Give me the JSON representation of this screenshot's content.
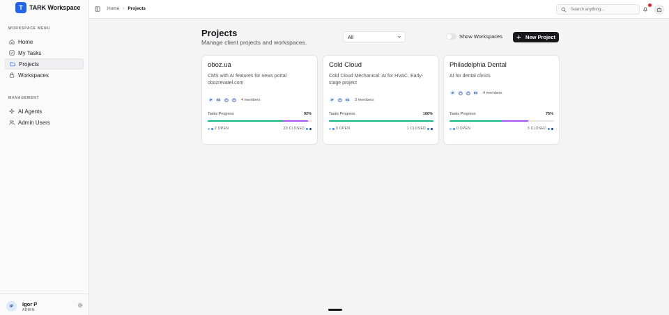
{
  "brand": {
    "logo_letter": "T",
    "name": "TARK Workspace",
    "accent": "#2563eb"
  },
  "sidebar": {
    "workspace_label": "WORKSPACE MENU",
    "workspace_items": [
      {
        "label": "Home",
        "icon": "home-icon"
      },
      {
        "label": "My Tasks",
        "icon": "checkbox-icon"
      },
      {
        "label": "Projects",
        "icon": "folder-icon",
        "active": true
      },
      {
        "label": "Workspaces",
        "icon": "lock-icon"
      }
    ],
    "management_label": "MANAGEMENT",
    "management_items": [
      {
        "label": "AI Agents",
        "icon": "sparkle-icon"
      },
      {
        "label": "Admin Users",
        "icon": "users-icon"
      }
    ],
    "user": {
      "initials": "IP",
      "name": "Igor P",
      "role": "ADMIN"
    }
  },
  "topbar": {
    "breadcrumb": [
      "Home",
      "Projects"
    ],
    "search_placeholder": "Search anything...",
    "notification_color": "#dc2626"
  },
  "page": {
    "title": "Projects",
    "subtitle": "Manage client projects and workspaces.",
    "filter_value": "All",
    "toggle_label": "Show Workspaces",
    "new_button_label": "New Project"
  },
  "projects": [
    {
      "name": "oboz.ua",
      "description": "CMS with AI features for news portal obozrevatel.com",
      "avatars": [
        "IP",
        "ES",
        "",
        ""
      ],
      "members": "4 members",
      "progress_label": "Tasks Progress",
      "progress_pct": "92%",
      "progress_done_fraction": 0.72,
      "progress_review_fraction": 0.24,
      "open": "2 OPEN",
      "closed": "23 CLOSED"
    },
    {
      "name": "Cold Cloud",
      "description": "Cold Cloud Mechanical: AI for HVAC. Early-stage project",
      "avatars": [
        "IP",
        "",
        "ES"
      ],
      "members": "3 members",
      "progress_label": "Tasks Progress",
      "progress_pct": "100%",
      "progress_done_fraction": 1.0,
      "progress_review_fraction": 0.0,
      "open": "0 OPEN",
      "closed": "1 CLOSED"
    },
    {
      "name": "Philadelphia Dental",
      "description": "AI for dental clinics",
      "avatars": [
        "IP",
        "",
        "",
        "ES"
      ],
      "members": "4 members",
      "progress_label": "Tasks Progress",
      "progress_pct": "75%",
      "progress_done_fraction": 0.5,
      "progress_review_fraction": 0.25,
      "open": "0 OPEN",
      "closed": "3 CLOSED"
    }
  ]
}
